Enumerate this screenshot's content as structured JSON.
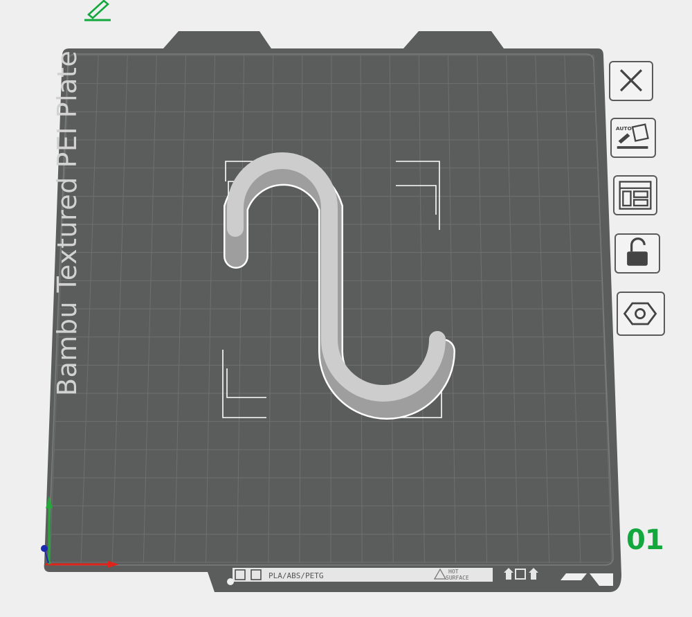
{
  "plate": {
    "name": "Bambu Textured PEI Plate",
    "number": "01",
    "label_filaments": "PLA/ABS/PETG",
    "label_hot_line1": "HOT",
    "label_hot_line2": "SURFACE"
  },
  "toolbar": {
    "edit": "pencil-icon",
    "buttons": [
      "close-icon",
      "auto-orient-icon",
      "arrange-icon",
      "lock-icon",
      "settings-hex-icon"
    ]
  },
  "colors": {
    "plate": "#5b5c5c",
    "grid": "#6f7070",
    "object": "#c9c9c9",
    "accent_green": "#12a83e",
    "axis_x": "#e0231b",
    "axis_y": "#24a83a",
    "axis_z": "#1a2bb0"
  }
}
